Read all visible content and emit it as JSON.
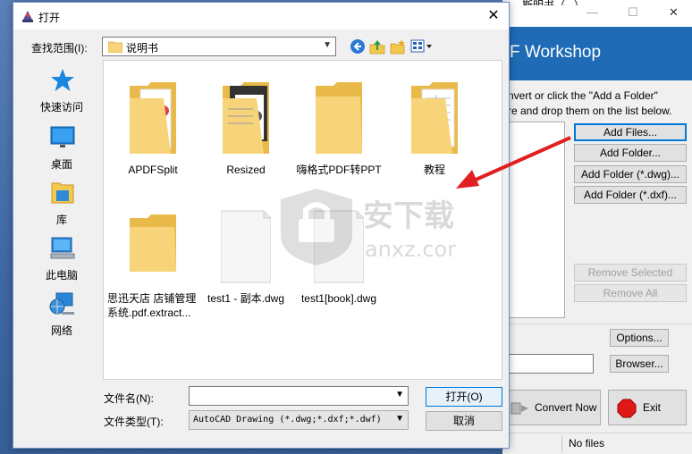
{
  "background_app": {
    "title_fragment": "斯明书（...）",
    "header_title": "F Workshop",
    "hint_line1": "nvert or click the \"Add a Folder\"",
    "hint_line2": "re and drop them on the list below.",
    "buttons": {
      "add_files": "Add Files...",
      "add_folder": "Add Folder...",
      "add_folder_dwg": "Add Folder (*.dwg)...",
      "add_folder_dxf": "Add Folder (*.dxf)...",
      "remove_selected": "Remove Selected",
      "remove_all": "Remove All",
      "options": "Options...",
      "browser": "Browser...",
      "convert_now": "Convert Now",
      "exit": "Exit"
    },
    "status_text": "No files",
    "minimize_glyph": "—",
    "maximize_glyph": "☐",
    "close_glyph": "✕"
  },
  "dialog": {
    "title": "打开",
    "close_glyph": "✕",
    "look_in_label": "查找范围(I):",
    "look_in_value": "说明书",
    "places": [
      "快速访问",
      "桌面",
      "库",
      "此电脑",
      "网络"
    ],
    "files": [
      {
        "name": "APDFSplit",
        "type": "folder-doc"
      },
      {
        "name": "Resized",
        "type": "folder-photo"
      },
      {
        "name": "嗨格式PDF转PPT",
        "type": "folder"
      },
      {
        "name": "教程",
        "type": "folder-sheet"
      },
      {
        "name": "思迅天店 店铺管理系统.pdf.extract...",
        "type": "folder"
      },
      {
        "name": "test1 - 副本.dwg",
        "type": "dwg"
      },
      {
        "name": "test1[book].dwg",
        "type": "dwg"
      }
    ],
    "file_name_label": "文件名(N):",
    "file_name_value": "",
    "file_type_label": "文件类型(T):",
    "file_type_value": "AutoCAD Drawing (*.dwg;*.dxf;*.dwf)",
    "open_button": "打开(O)",
    "cancel_button": "取消",
    "dropdown_glyph": "▼"
  },
  "watermark": {
    "main": "安下载",
    "sub": "anxz.com"
  },
  "colors": {
    "accent": "#0078d7",
    "header_blue": "#1f6bb5",
    "arrow": "#e02020",
    "folder": "#f7d47a"
  }
}
